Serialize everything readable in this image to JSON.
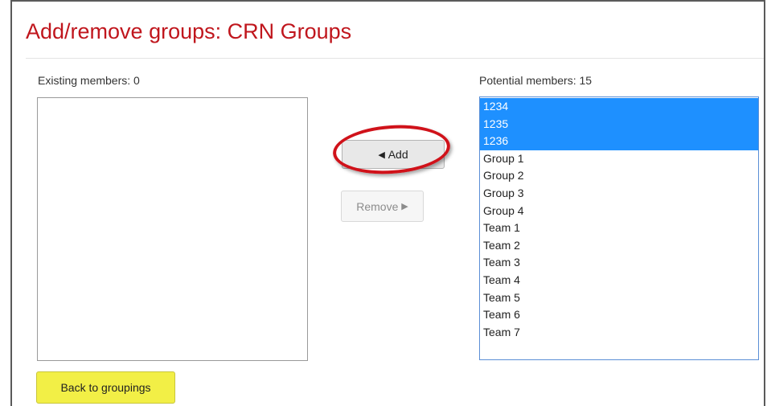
{
  "page": {
    "title": "Add/remove groups: CRN Groups"
  },
  "existing": {
    "label": "Existing members: 0",
    "items": []
  },
  "potential": {
    "label": "Potential members: 15",
    "items": [
      {
        "label": "1234",
        "selected": true
      },
      {
        "label": "1235",
        "selected": true
      },
      {
        "label": "1236",
        "selected": true
      },
      {
        "label": "Group 1",
        "selected": false
      },
      {
        "label": "Group 2",
        "selected": false
      },
      {
        "label": "Group 3",
        "selected": false
      },
      {
        "label": "Group 4",
        "selected": false
      },
      {
        "label": "Team 1",
        "selected": false
      },
      {
        "label": "Team 2",
        "selected": false
      },
      {
        "label": "Team 3",
        "selected": false
      },
      {
        "label": "Team 4",
        "selected": false
      },
      {
        "label": "Team 5",
        "selected": false
      },
      {
        "label": "Team 6",
        "selected": false
      },
      {
        "label": "Team 7",
        "selected": false
      }
    ]
  },
  "actions": {
    "add_arrow": "◀",
    "add_label": "Add",
    "remove_label": "Remove",
    "remove_arrow": "▶",
    "back_label": "Back to groupings"
  },
  "colors": {
    "title": "#c0161d",
    "selected_bg": "#1e90ff",
    "back_button": "#f2ef46",
    "highlight_ring": "#d0121a"
  }
}
